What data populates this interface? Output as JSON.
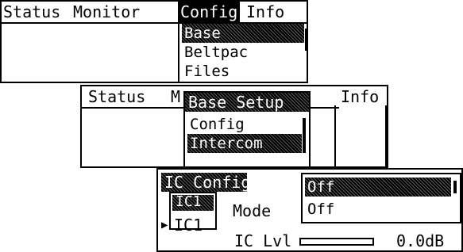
{
  "screen1": {
    "menu": [
      "Status",
      "Monitor",
      "Config",
      "Info"
    ],
    "dropdown": [
      "Base",
      "Beltpac",
      "Files"
    ]
  },
  "screen2": {
    "menu": [
      "Status",
      "M",
      "Info"
    ],
    "dialog_title": "Base Setup",
    "items": [
      "Config",
      "Intercom"
    ]
  },
  "screen3": {
    "title": "IC Config",
    "channel_selected": "IC1",
    "channel_value": "IC1",
    "mode_label": "Mode",
    "mode_options": [
      "Off",
      "Off"
    ],
    "level_label": "IC Lvl",
    "level_value": "0.0dB"
  }
}
